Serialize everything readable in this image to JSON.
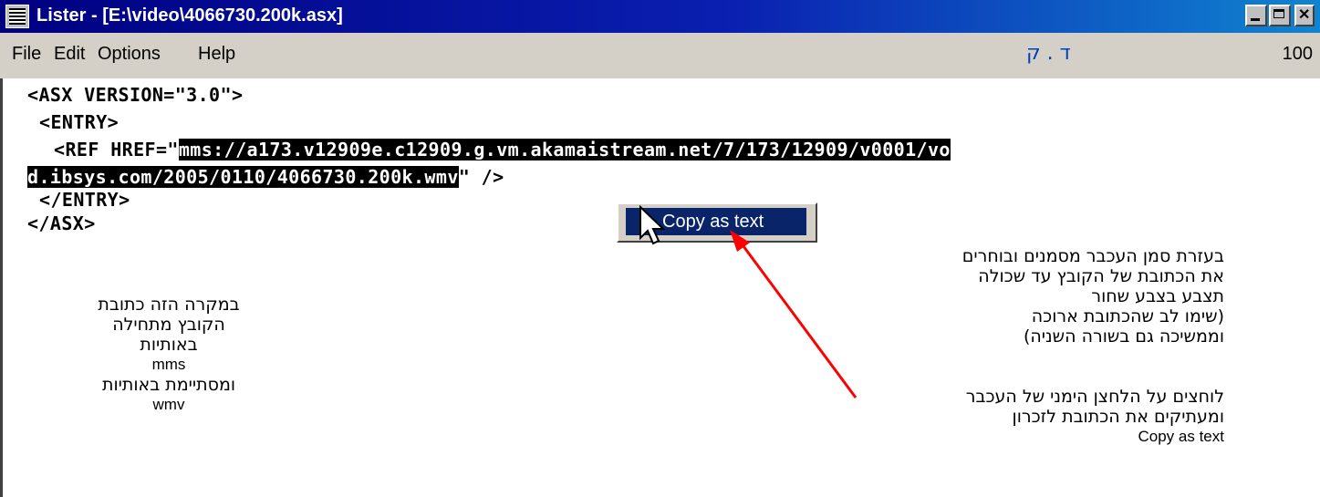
{
  "window": {
    "title": "Lister - [E:\\video\\4066730.200k.asx]"
  },
  "menubar": {
    "items": [
      "File",
      "Edit",
      "Options",
      "Help"
    ],
    "status_hebrew": "ד . ק",
    "zoom": "100"
  },
  "code": {
    "line1": "<ASX VERSION=\"3.0\">",
    "line2": "<ENTRY>",
    "line3_prefix": "<REF HREF=\"",
    "line3_selected": "mms://a173.v12909e.c12909.g.vm.akamaistream.net/7/173/12909/v0001/vo",
    "line4_selected": "d.ibsys.com/2005/0110/4066730.200k.wmv",
    "line4_suffix": "\" />",
    "line5": "</ENTRY>",
    "line6": "</ASX>"
  },
  "context_menu": {
    "item": "Copy as text"
  },
  "notes": {
    "right_block": [
      "בעזרת סמן העכבר מסמנים ובוחרים",
      "את הכתובת של הקובץ עד שכולה",
      "תצבע בצבע שחור",
      "(שימו  לב שהכתובת ארוכה",
      "וממשיכה גם בשורה השניה)"
    ],
    "right_block2": [
      "לוחצים על הלחצן הימני של העכבר",
      "ומעתיקים את הכתובת לזכרון"
    ],
    "right_block2_en": "Copy as text",
    "left_block": [
      "במקרה הזה כתובת",
      "הקובץ מתחילה",
      "באותיות"
    ],
    "left_mms": "mms",
    "left_block2": "ומסתיימת באותיות",
    "left_wmv": "wmv"
  },
  "colors": {
    "titlebar": "#0a246a",
    "arrow": "#ff0000",
    "selection": "#000000"
  }
}
